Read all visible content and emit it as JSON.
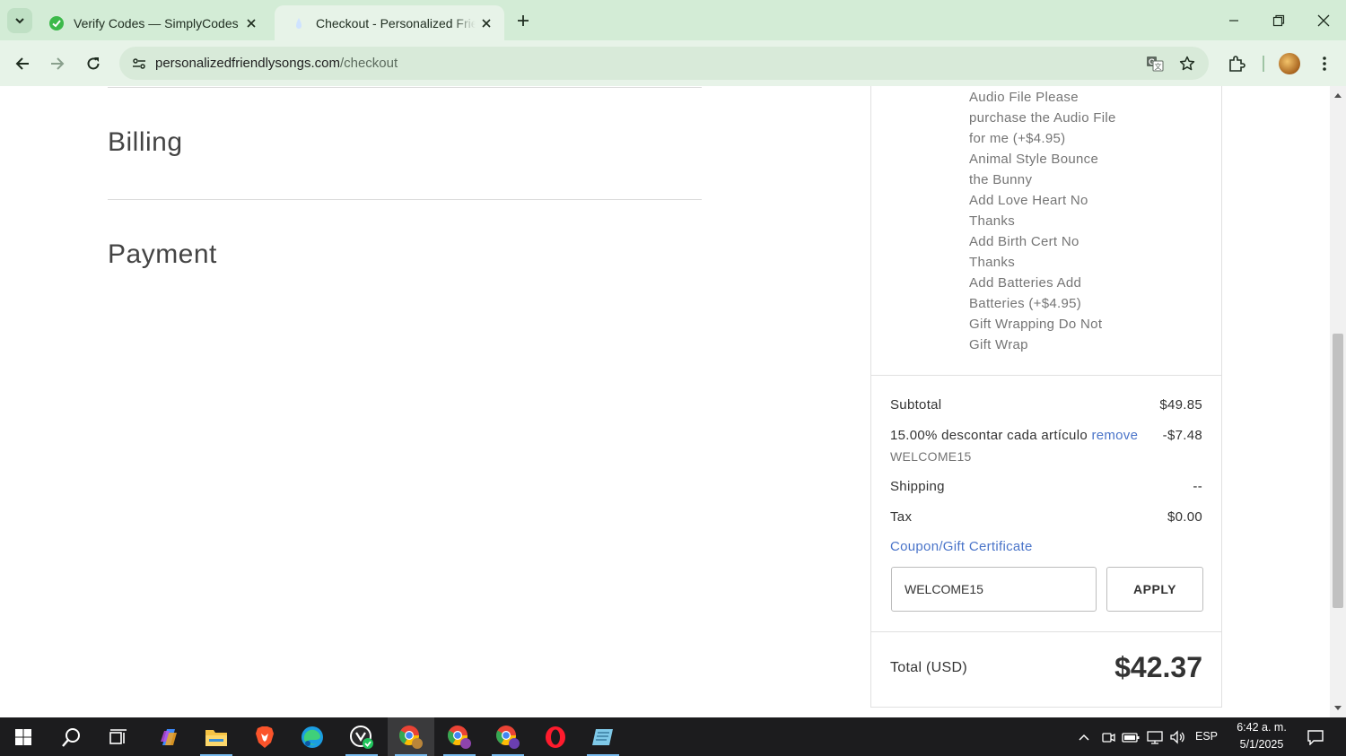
{
  "browser": {
    "tabs": [
      {
        "title": "Verify Codes — SimplyCodes",
        "favicon": "simplycodes-icon",
        "active": false
      },
      {
        "title": "Checkout - Personalized Friendly Songs",
        "favicon": "song-favicon",
        "active": true
      }
    ],
    "url_host": "personalizedfriendlysongs.com",
    "url_path": "/checkout"
  },
  "page": {
    "billing_heading": "Billing",
    "payment_heading": "Payment"
  },
  "order_summary": {
    "option_lines": [
      "Audio File Please",
      "purchase the Audio File",
      "for me (+$4.95)",
      "Animal Style Bounce",
      "the Bunny",
      "Add Love Heart No",
      "Thanks",
      "Add Birth Cert No",
      "Thanks",
      "Add Batteries Add",
      "Batteries (+$4.95)",
      "Gift Wrapping Do Not",
      "Gift Wrap"
    ],
    "subtotal_label": "Subtotal",
    "subtotal_value": "$49.85",
    "discount_label": "15.00% descontar cada artículo",
    "discount_remove": "remove",
    "discount_value": "-$7.48",
    "discount_code": "WELCOME15",
    "shipping_label": "Shipping",
    "shipping_value": "--",
    "tax_label": "Tax",
    "tax_value": "$0.00",
    "coupon_link": "Coupon/Gift Certificate",
    "coupon_input_value": "WELCOME15",
    "apply_label": "APPLY",
    "total_label": "Total (USD)",
    "total_value": "$42.37"
  },
  "taskbar": {
    "language": "ESP",
    "time": "6:42 a. m.",
    "date": "5/1/2025"
  },
  "colors": {
    "tabbar_bg": "#d3ecd6",
    "toolbar_bg": "#e7f3e8",
    "link": "#4a74c9",
    "taskbar_bg": "#1c1c1e"
  }
}
